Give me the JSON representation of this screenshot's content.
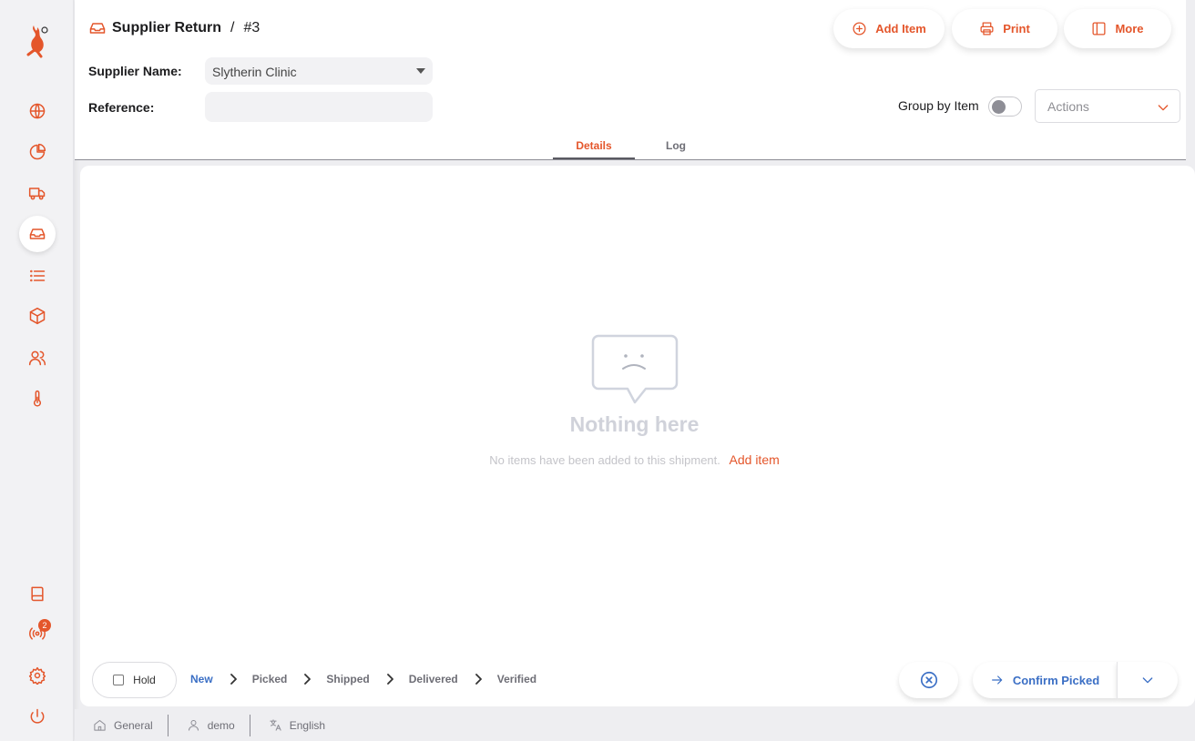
{
  "sidebar": {
    "logo": "flame-runner-logo",
    "items": [
      {
        "icon": "globe-icon"
      },
      {
        "icon": "pie-chart-icon"
      },
      {
        "icon": "truck-icon"
      },
      {
        "icon": "inbox-icon",
        "active": true
      },
      {
        "icon": "list-icon"
      },
      {
        "icon": "package-icon"
      },
      {
        "icon": "users-icon"
      },
      {
        "icon": "thermometer-icon"
      }
    ],
    "bottom": [
      {
        "icon": "book-icon"
      },
      {
        "icon": "radio-icon",
        "badge": "2"
      },
      {
        "icon": "settings-icon"
      },
      {
        "icon": "power-icon"
      }
    ]
  },
  "header": {
    "title": "Supplier Return",
    "separator": "/",
    "number": "#3",
    "buttons": {
      "add_item": "Add Item",
      "print": "Print",
      "more": "More"
    },
    "supplier_label": "Supplier Name:",
    "supplier_value": "Slytherin Clinic",
    "reference_label": "Reference:",
    "reference_value": "",
    "group_by_label": "Group by Item",
    "group_by_on": false,
    "actions_placeholder": "Actions",
    "tabs": [
      {
        "label": "Details",
        "active": true
      },
      {
        "label": "Log",
        "active": false
      }
    ]
  },
  "empty_state": {
    "title": "Nothing here",
    "description": "No items have been added to this shipment.",
    "link": "Add item"
  },
  "status_bar": {
    "hold_label": "Hold",
    "steps": [
      "New",
      "Picked",
      "Shipped",
      "Delivered",
      "Verified"
    ],
    "current_step": "New",
    "confirm_label": "Confirm Picked"
  },
  "footer": {
    "store": "General",
    "user": "demo",
    "language": "English"
  },
  "colors": {
    "accent": "#e4562b",
    "primary_blue": "#3b6fc5"
  }
}
